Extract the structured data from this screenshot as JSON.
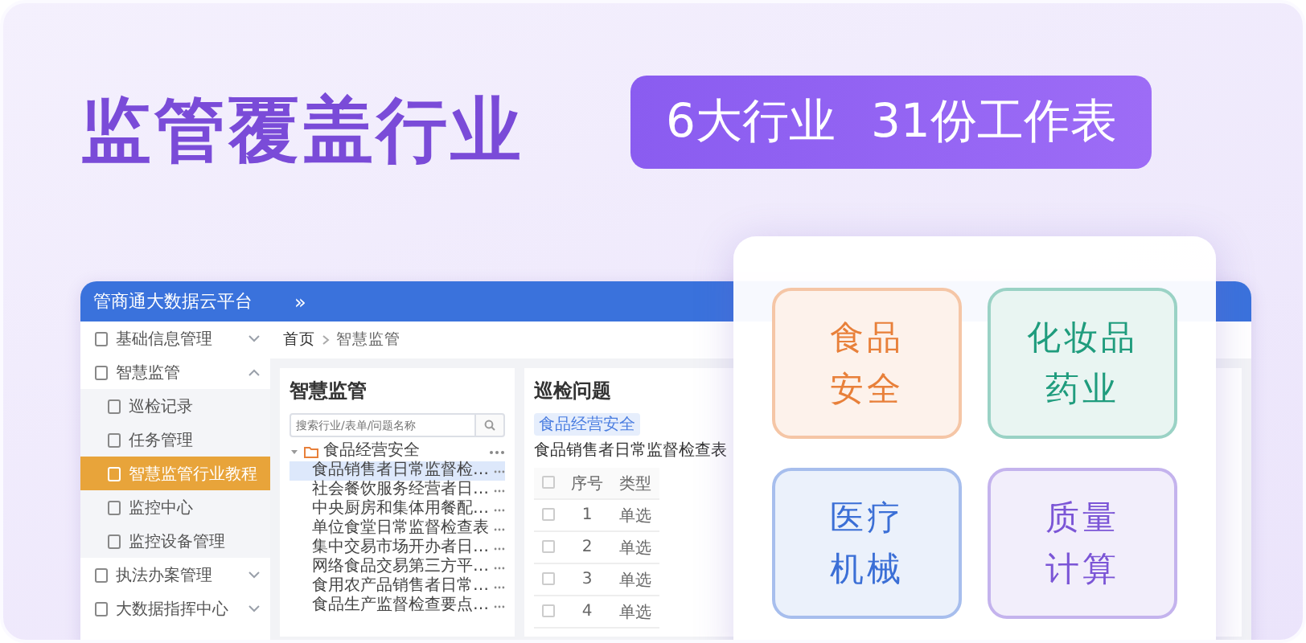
{
  "hero": {
    "title": "监管覆盖行业",
    "badge": [
      "6大行业",
      "31份工作表"
    ]
  },
  "app": {
    "title": "管商通大数据云平台",
    "collapse_glyph": "»",
    "breadcrumb": [
      "首页",
      "智慧监管"
    ],
    "sidebar": [
      {
        "label": "基础信息管理",
        "expanded": false,
        "selected": false
      },
      {
        "label": "智慧监管",
        "expanded": true,
        "selected": false,
        "children": [
          {
            "label": "巡检记录",
            "selected": false
          },
          {
            "label": "任务管理",
            "selected": false
          },
          {
            "label": "智慧监管行业教程",
            "selected": true
          },
          {
            "label": "监控中心",
            "selected": false
          },
          {
            "label": "监控设备管理",
            "selected": false
          }
        ]
      },
      {
        "label": "执法办案管理",
        "expanded": false,
        "selected": false
      },
      {
        "label": "大数据指挥中心",
        "expanded": false,
        "selected": false
      }
    ],
    "tree_panel": {
      "title": "智慧监管",
      "search": {
        "placeholder": "搜索行业/表单/问题名称"
      },
      "tree": [
        {
          "label": "食品经营安全",
          "expanded": true,
          "selected": false,
          "children": [
            {
              "label": "食品销售者日常监督检…",
              "selected": true
            },
            {
              "label": "社会餐饮服务经营者日…",
              "selected": false
            },
            {
              "label": "中央厨房和集体用餐配…",
              "selected": false
            },
            {
              "label": "单位食堂日常监督检查表",
              "selected": false
            },
            {
              "label": "集中交易市场开办者日…",
              "selected": false
            },
            {
              "label": "网络食品交易第三方平…",
              "selected": false
            },
            {
              "label": "食用农产品销售者日常…",
              "selected": false
            },
            {
              "label": "食品生产监督检查要点…",
              "selected": false
            }
          ]
        }
      ]
    },
    "issues_panel": {
      "title": "巡检问题",
      "tag": "食品经营安全",
      "subtitle": "食品销售者日常监督检查表",
      "table": {
        "header_checked": false,
        "columns": [
          "序号",
          "类型"
        ],
        "rows": [
          {
            "checked": false,
            "cells": [
              "1",
              "单选"
            ]
          },
          {
            "checked": false,
            "cells": [
              "2",
              "单选"
            ]
          },
          {
            "checked": false,
            "cells": [
              "3",
              "单选"
            ]
          },
          {
            "checked": false,
            "cells": [
              "4",
              "单选"
            ]
          }
        ]
      }
    }
  },
  "industries": [
    {
      "lines": [
        "食品",
        "安全"
      ],
      "color": "#e8803a"
    },
    {
      "lines": [
        "化妆品",
        "药业"
      ],
      "color": "#1f9c7d"
    },
    {
      "lines": [
        "医疗",
        "机械"
      ],
      "color": "#3b6fd6"
    },
    {
      "lines": [
        "质量",
        "计算"
      ],
      "color": "#7b55d6"
    }
  ]
}
